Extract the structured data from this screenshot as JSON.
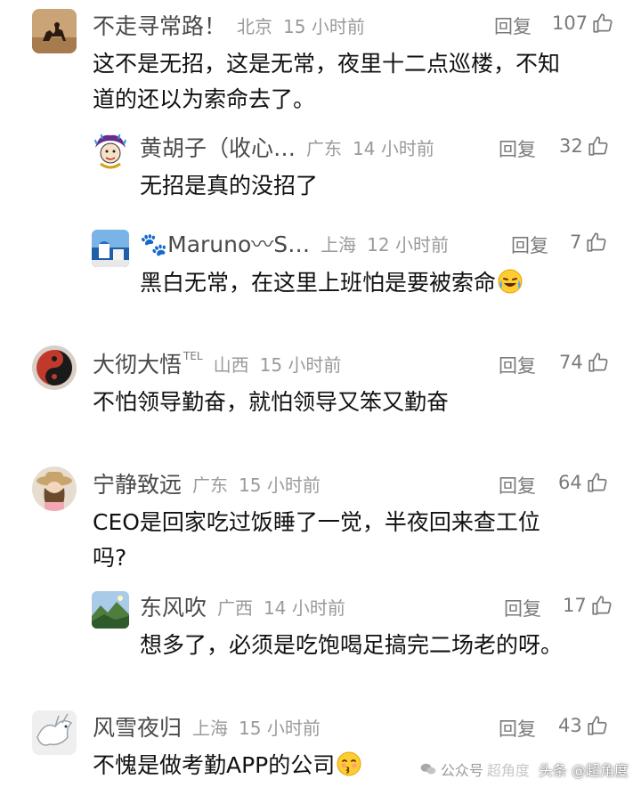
{
  "reply_label": "回复",
  "comments": [
    {
      "name": "不走寻常路！",
      "location": "北京",
      "time": "15 小时前",
      "likes": "107",
      "text_lines": [
        "这不是无招，这是无常，夜里十二点巡楼，不知",
        "道的还以为索命去了。"
      ],
      "avatar": "camel-silhouette"
    },
    {
      "name": "黄胡子（收心…",
      "location": "广东",
      "time": "14 小时前",
      "likes": "32",
      "text_lines": [
        "无招是真的没招了"
      ],
      "avatar": "colorful-hair-character"
    },
    {
      "name": "🐾Maruno〰S…",
      "location": "上海",
      "time": "12 小时前",
      "likes": "7",
      "text_lines": [
        "黑白无常，在这里上班怕是要被索命"
      ],
      "avatar": "seaside-white-building",
      "emoji": "laughing-crying-emoji"
    },
    {
      "name": "大彻大悟",
      "name_tag": "TEL",
      "location": "山西",
      "time": "15 小时前",
      "likes": "74",
      "text_lines": [
        "不怕领导勤奋，就怕领导又笨又勤奋"
      ],
      "avatar": "taiji-red-black"
    },
    {
      "name": "宁静致远",
      "location": "广东",
      "time": "15 小时前",
      "likes": "64",
      "text_lines": [
        "CEO是回家吃过饭睡了一觉，半夜回来查工位",
        "吗?"
      ],
      "avatar": "girl-in-hat"
    },
    {
      "name": "东风吹",
      "location": "广西",
      "time": "14 小时前",
      "likes": "17",
      "text_lines": [
        "想多了，必须是吃饱喝足搞完二场老的呀。"
      ],
      "avatar": "mountain-landscape"
    },
    {
      "name": "风雪夜归",
      "location": "上海",
      "time": "15 小时前",
      "likes": "43",
      "text_lines": [
        "不愧是做考勤APP的公司"
      ],
      "avatar": "white-dragon",
      "emoji": "kissing-emoji"
    }
  ],
  "watermark": {
    "prefix": "公众号",
    "faded": "超角度",
    "text": "头条 @超角度"
  }
}
